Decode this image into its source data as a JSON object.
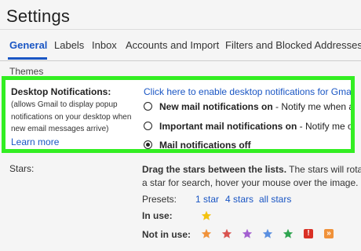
{
  "page": {
    "title": "Settings"
  },
  "tabs": [
    {
      "label": "General",
      "active": true
    },
    {
      "label": "Labels"
    },
    {
      "label": "Inbox"
    },
    {
      "label": "Accounts and Import"
    },
    {
      "label": "Filters and Blocked Addresses"
    }
  ],
  "themes_label": "Themes",
  "desktop_notifications": {
    "heading": "Desktop Notifications:",
    "description": "(allows Gmail to display popup notifications on your desktop when new email messages arrive)",
    "learn_more": "Learn more",
    "enable_link": "Click here to enable desktop notifications for Gmail.",
    "options": [
      {
        "bold": "New mail notifications on",
        "rest": " - Notify me when any new",
        "checked": false
      },
      {
        "bold": "Important mail notifications on",
        "rest": " - Notify me only when",
        "checked": false
      },
      {
        "bold": "Mail notifications off",
        "rest": "",
        "checked": true
      }
    ],
    "highlight_color": "#33ee22"
  },
  "stars": {
    "label": "Stars:",
    "desc_bold": "Drag the stars between the lists.",
    "desc_line1_rest": "  The stars will rotate",
    "desc_line2": "a star for search, hover your mouse over the image.",
    "presets_label": "Presets:",
    "presets": [
      "1 star",
      "4 stars",
      "all stars"
    ],
    "in_use_label": "In use:",
    "not_in_use_label": "Not in use:",
    "in_use_icons": [
      {
        "icon": "yellow-star-icon",
        "color": "#f4c20d"
      }
    ],
    "not_in_use_icons": [
      {
        "icon": "orange-star-icon",
        "color": "#f0923a"
      },
      {
        "icon": "red-star-icon",
        "color": "#d9534f"
      },
      {
        "icon": "purple-star-icon",
        "color": "#a35fd0"
      },
      {
        "icon": "blue-star-icon",
        "color": "#5a8fe0"
      },
      {
        "icon": "green-star-icon",
        "color": "#2ea44f"
      },
      {
        "icon": "red-bang-icon",
        "color": "#d93025",
        "glyph": "!"
      },
      {
        "icon": "orange-guillemet-icon",
        "color": "#f0923a",
        "glyph": "»"
      }
    ]
  }
}
